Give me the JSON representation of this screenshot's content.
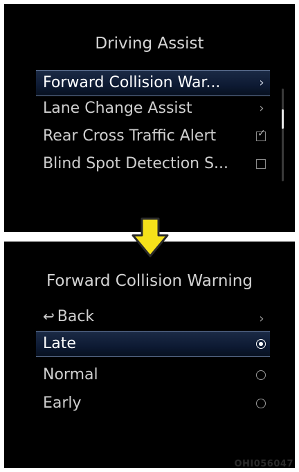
{
  "top_panel": {
    "title": "Driving Assist",
    "items": [
      {
        "label": "Forward Collision War...",
        "control": "chevron",
        "selected": true
      },
      {
        "label": "Lane Change Assist",
        "control": "chevron",
        "selected": false
      },
      {
        "label": "Rear Cross Traffic Alert",
        "control": "checkbox",
        "checked": true
      },
      {
        "label": "Blind Spot Detection S...",
        "control": "checkbox",
        "checked": false
      }
    ]
  },
  "bottom_panel": {
    "title": "Forward Collision Warning",
    "back_label": "Back",
    "options": [
      {
        "label": "Late",
        "selected": true
      },
      {
        "label": "Normal",
        "selected": false
      },
      {
        "label": "Early",
        "selected": false
      }
    ]
  },
  "icons": {
    "chevron": "›",
    "checkmark": "☑",
    "back": "↩",
    "transition_arrow": "down-arrow-icon"
  },
  "colors": {
    "background": "#000000",
    "highlight": "#0d1a33",
    "arrow_fill": "#f5e11a"
  },
  "watermark": "OHI056047"
}
